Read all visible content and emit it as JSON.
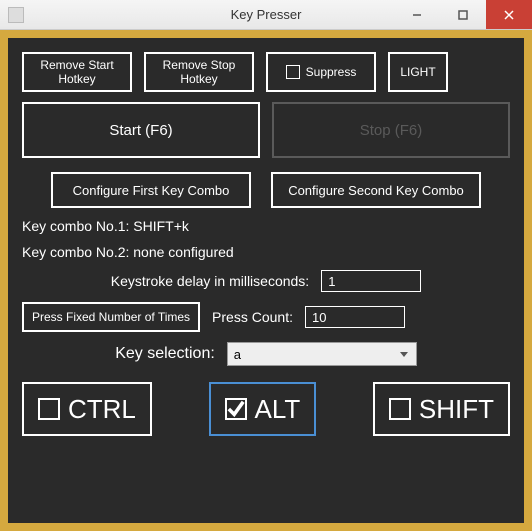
{
  "window": {
    "title": "Key Presser"
  },
  "top": {
    "remove_start": "Remove Start\nHotkey",
    "remove_stop": "Remove Stop\nHotkey",
    "suppress": "Suppress",
    "light": "LIGHT"
  },
  "main": {
    "start": "Start (F6)",
    "stop": "Stop (F6)"
  },
  "config": {
    "first": "Configure First Key Combo",
    "second": "Configure Second Key Combo"
  },
  "combos": {
    "line1": "Key combo No.1: SHIFT+k",
    "line2": "Key combo No.2: none configured"
  },
  "delay": {
    "label": "Keystroke delay in milliseconds:",
    "value": "1"
  },
  "press": {
    "fixed_btn": "Press Fixed Number of Times",
    "count_label": "Press Count:",
    "count_value": "10"
  },
  "keysel": {
    "label": "Key selection:",
    "value": "a"
  },
  "mods": {
    "ctrl": "CTRL",
    "alt": "ALT",
    "shift": "SHIFT"
  }
}
